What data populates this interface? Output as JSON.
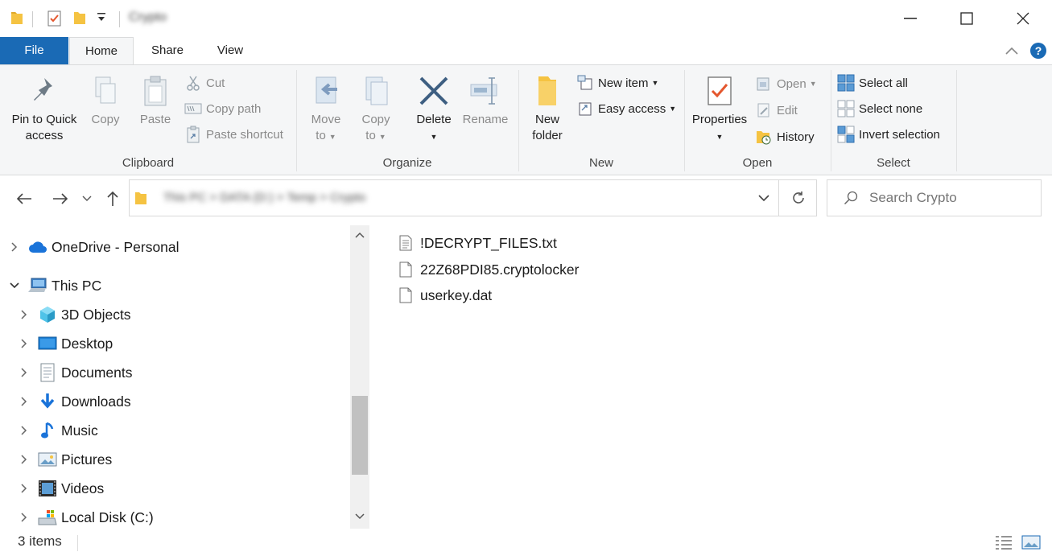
{
  "window": {
    "title": "Crypto",
    "minimize_symbol": "—",
    "close_symbol": "✕"
  },
  "tabs": [
    {
      "label": "File"
    },
    {
      "label": "Home"
    },
    {
      "label": "Share"
    },
    {
      "label": "View"
    }
  ],
  "ribbon": {
    "clipboard": {
      "label": "Clipboard",
      "pin": "Pin to Quick",
      "pin2": "access",
      "copy": "Copy",
      "paste": "Paste",
      "cut": "Cut",
      "copy_path": "Copy path",
      "paste_shortcut": "Paste shortcut"
    },
    "organize": {
      "label": "Organize",
      "move": "Move",
      "move2": "to",
      "copy": "Copy",
      "copy2": "to",
      "delete": "Delete",
      "rename": "Rename"
    },
    "new": {
      "label": "New",
      "new_folder": "New",
      "new_folder2": "folder",
      "new_item": "New item",
      "easy_access": "Easy access"
    },
    "open": {
      "label": "Open",
      "properties": "Properties",
      "open": "Open",
      "edit": "Edit",
      "history": "History"
    },
    "select": {
      "label": "Select",
      "select_all": "Select all",
      "select_none": "Select none",
      "invert": "Invert selection"
    }
  },
  "address": {
    "crumbs": "This PC  >  DATA (D:)  >  Temp  >  Crypto"
  },
  "search": {
    "placeholder": "Search Crypto"
  },
  "nav_tree": [
    {
      "label": "OneDrive - Personal"
    },
    {
      "label": "This PC"
    },
    {
      "label": "3D Objects"
    },
    {
      "label": "Desktop"
    },
    {
      "label": "Documents"
    },
    {
      "label": "Downloads"
    },
    {
      "label": "Music"
    },
    {
      "label": "Pictures"
    },
    {
      "label": "Videos"
    },
    {
      "label": "Local Disk (C:)"
    }
  ],
  "files": [
    {
      "name": "!DECRYPT_FILES.txt",
      "type": "text-file-icon"
    },
    {
      "name": "22Z68PDI85.cryptolocker",
      "type": "blank-file-icon"
    },
    {
      "name": "userkey.dat",
      "type": "blank-file-icon"
    }
  ],
  "status": {
    "count": "3 items"
  },
  "colors": {
    "accent": "#1a6ab5",
    "folder": "#f5c342",
    "ribbon_bg": "#f5f6f7"
  }
}
